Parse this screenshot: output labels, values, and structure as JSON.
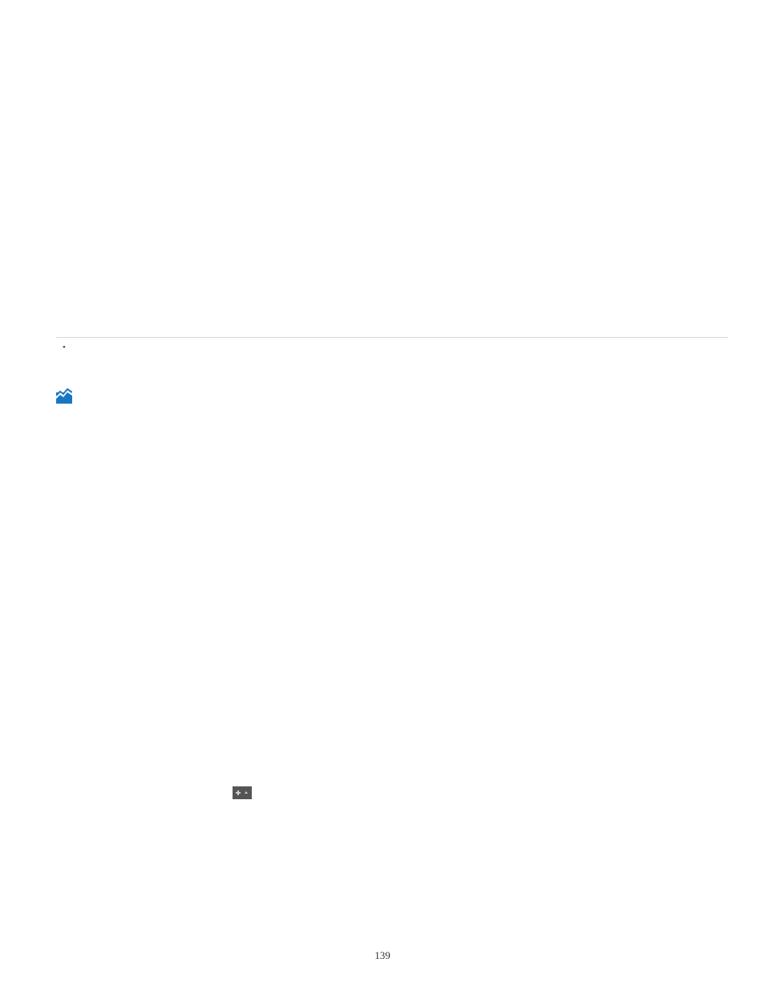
{
  "bullets": {
    "item1": "",
    "item2": ""
  },
  "page_number": "139"
}
